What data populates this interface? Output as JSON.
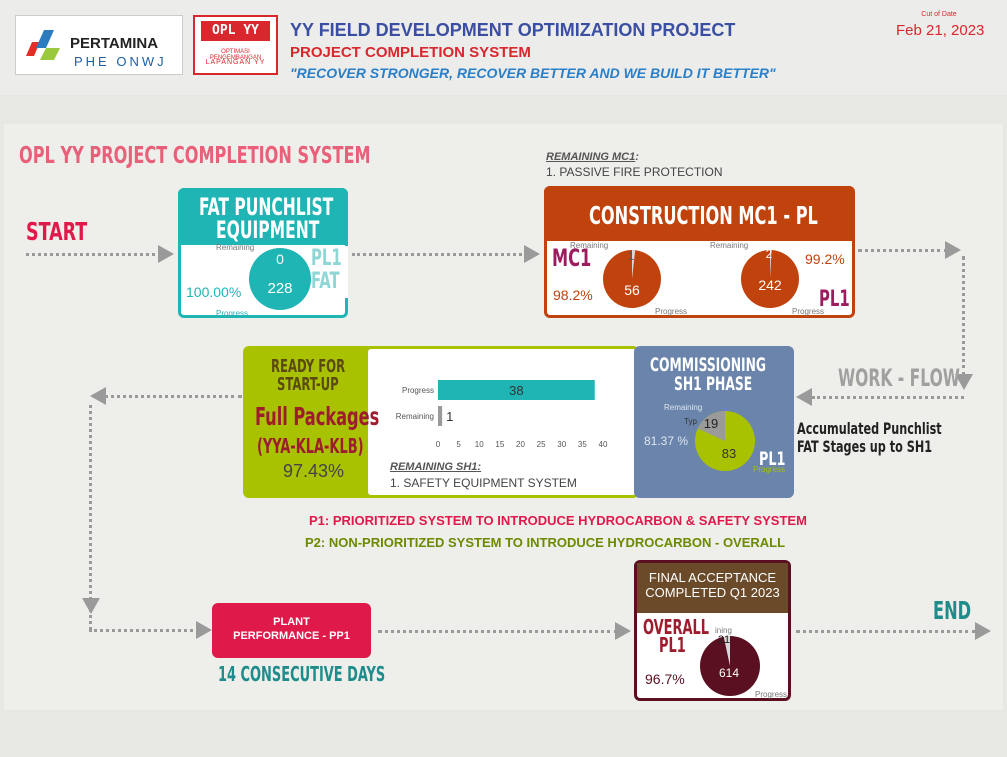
{
  "header": {
    "logo_name": "PERTAMINA",
    "logo_sub": "PHE  ONWJ",
    "opl_title": "OPL YY",
    "opl_sub1": "OPTIMASI PENGEMBANGAN",
    "opl_sub2": "LAPANGAN YY",
    "title": "YY FIELD DEVELOPMENT OPTIMIZATION PROJECT",
    "subtitle": "PROJECT COMPLETION SYSTEM",
    "slogan": "\"RECOVER STRONGER, RECOVER BETTER AND WE BUILD IT BETTER\"",
    "cut_off_label": "Cut of Date",
    "cut_off_date": "Feb 21, 2023"
  },
  "page_title": "OPL YY PROJECT COMPLETION SYSTEM",
  "start_label": "START",
  "end_label": "END",
  "workflow_label": "WORK - FLOW",
  "fat": {
    "title1": "FAT PUNCHLIST",
    "title2": "EQUIPMENT",
    "remaining_label": "Remaining",
    "progress_label": "Progress",
    "remaining": "0",
    "progress": "228",
    "percent": "100.00%",
    "tag1": "PL1",
    "tag2": "FAT"
  },
  "mc1": {
    "remaining_title": "REMAINING MC1",
    "remaining_colon": ":",
    "remaining_item": "1. PASSIVE FIRE PROTECTION",
    "title": "CONSTRUCTION MC1 - PL",
    "left_tag": "MC1",
    "left_remaining_label": "Remaining",
    "left_remaining": "1",
    "left_progress": "56",
    "left_progress_label": "Progress",
    "left_percent": "98.2%",
    "right_remaining_label": "Remaining",
    "right_remaining": "2",
    "right_progress": "242",
    "right_progress_label": "Progress",
    "right_percent": "99.2%",
    "right_tag": "PL1"
  },
  "ready": {
    "title1": "READY FOR",
    "title2": "START-UP",
    "packages": "Full Packages",
    "areas": "(YYA-KLA-KLB)",
    "percent": "97.43%"
  },
  "sh1_bars": {
    "labels": [
      "Progress",
      "Remaining"
    ],
    "values": [
      38,
      1
    ],
    "ticks": [
      "0",
      "5",
      "10",
      "15",
      "20",
      "25",
      "30",
      "35",
      "40"
    ],
    "xmax": 40,
    "remaining_title": "REMAINING SH1",
    "remaining_colon": ":",
    "remaining_item": "1. SAFETY EQUIPMENT SYSTEM"
  },
  "comm": {
    "title1": "COMMISSIONING",
    "title2": "SH1 PHASE",
    "remaining_label": "Remaining",
    "type_label": "Typ",
    "remaining": "19",
    "progress": "83",
    "progress_label": "Progress",
    "percent": "81.37 %",
    "tag": "PL1"
  },
  "accum": {
    "line1": "Accumulated Punchlist",
    "line2": "FAT Stages up to SH1"
  },
  "legend": {
    "p1": "P1: PRIORITIZED SYSTEM TO INTRODUCE HYDROCARBON & SAFETY SYSTEM",
    "p2": "P2: NON-PRIORITIZED SYSTEM TO INTRODUCE HYDROCARBON - OVERALL"
  },
  "plant": {
    "line1": "PLANT",
    "line2": "PERFORMANCE - PP1",
    "days": "14 CONSECUTIVE DAYS"
  },
  "final": {
    "title1": "FINAL ACCEPTANCE",
    "title2": "COMPLETED Q1 2023",
    "tag1": "OVERALL",
    "tag2": "PL1",
    "remaining_label": "ining",
    "remaining": "21",
    "progress": "614",
    "progress_label": "Progress",
    "percent": "96.7%"
  },
  "colors": {
    "teal": "#1fb5b5",
    "rust": "#c0420c",
    "olive": "#a8c200",
    "slate": "#6a84ab",
    "crimson": "#e0194b",
    "maroon": "#5a1020",
    "brown": "#6b4a2a"
  },
  "chart_data": [
    {
      "type": "pie",
      "name": "FAT",
      "labels": [
        "Remaining",
        "Progress"
      ],
      "values": [
        0,
        228
      ]
    },
    {
      "type": "pie",
      "name": "MC1",
      "labels": [
        "Remaining",
        "Progress"
      ],
      "values": [
        1,
        56
      ]
    },
    {
      "type": "pie",
      "name": "PL1",
      "labels": [
        "Remaining",
        "Progress"
      ],
      "values": [
        2,
        242
      ]
    },
    {
      "type": "bar",
      "name": "SH1",
      "categories": [
        "Progress",
        "Remaining"
      ],
      "values": [
        38,
        1
      ],
      "xlim": [
        0,
        40
      ]
    },
    {
      "type": "pie",
      "name": "Commissioning",
      "labels": [
        "Remaining",
        "Progress"
      ],
      "values": [
        19,
        83
      ]
    },
    {
      "type": "pie",
      "name": "Final Acceptance",
      "labels": [
        "Remaining",
        "Progress"
      ],
      "values": [
        21,
        614
      ]
    }
  ]
}
